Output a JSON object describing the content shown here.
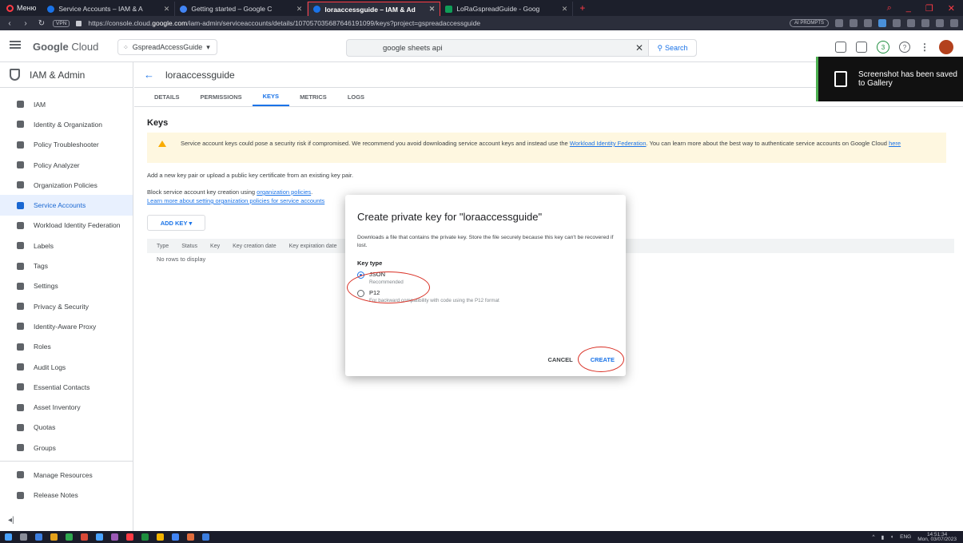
{
  "browser": {
    "menu_label": "Меню",
    "tabs": [
      {
        "label": "Service Accounts – IAM & A",
        "color": "#1a73e8",
        "active": false
      },
      {
        "label": "Getting started – Google C",
        "color": "#4285f4",
        "active": false
      },
      {
        "label": "loraaccessguide – IAM & Ad",
        "color": "#1a73e8",
        "active": true
      },
      {
        "label": "LoRaGspreadGuide - Goog",
        "color": "#0f9d58",
        "active": false
      }
    ],
    "url_prefix": "https://console.cloud.",
    "url_domain": "google.com",
    "url_suffix": "/iam-admin/serviceaccounts/details/107057035687646191099/keys?project=gspreadaccessguide",
    "vpn_label": "VPN",
    "ai_label": "AI PROMPTS"
  },
  "gcbar": {
    "logo_google": "Google",
    "logo_cloud": "Cloud",
    "project": "GspreadAccessGuide",
    "search_query": "google sheets api",
    "search_button": "Search",
    "notif_count": "3"
  },
  "toast": {
    "line1": "Screenshot has been saved",
    "line2": "to Gallery"
  },
  "sidebar": {
    "title": "IAM & Admin",
    "items": [
      {
        "label": "IAM"
      },
      {
        "label": "Identity & Organization"
      },
      {
        "label": "Policy Troubleshooter"
      },
      {
        "label": "Policy Analyzer"
      },
      {
        "label": "Organization Policies"
      },
      {
        "label": "Service Accounts"
      },
      {
        "label": "Workload Identity Federation"
      },
      {
        "label": "Labels"
      },
      {
        "label": "Tags"
      },
      {
        "label": "Settings"
      },
      {
        "label": "Privacy & Security"
      },
      {
        "label": "Identity-Aware Proxy"
      },
      {
        "label": "Roles"
      },
      {
        "label": "Audit Logs"
      },
      {
        "label": "Essential Contacts"
      },
      {
        "label": "Asset Inventory"
      },
      {
        "label": "Quotas"
      },
      {
        "label": "Groups"
      }
    ],
    "bottom_items": [
      {
        "label": "Manage Resources"
      },
      {
        "label": "Release Notes"
      }
    ],
    "collapse": "◂|"
  },
  "main": {
    "title": "loraaccessguide",
    "tabs": [
      "DETAILS",
      "PERMISSIONS",
      "KEYS",
      "METRICS",
      "LOGS"
    ],
    "keys_heading": "Keys",
    "warning_text": "Service account keys could pose a security risk if compromised. We recommend you avoid downloading service account keys and instead use the",
    "warning_link": "Workload Identity Federation",
    "warning_text2": ". You can learn more about the best way to authenticate service accounts on Google Cloud",
    "warning_here": "here",
    "add_text": "Add a new key pair or upload a public key certificate from an existing key pair.",
    "block_text": "Block service account key creation using",
    "block_link": "organization policies",
    "learn_link": "Learn more about setting organization policies for service accounts",
    "add_key": "ADD KEY",
    "columns": [
      "Type",
      "Status",
      "Key",
      "Key creation date",
      "Key expiration date"
    ],
    "no_rows": "No rows to display"
  },
  "modal": {
    "title": "Create private key for \"loraaccessguide\"",
    "description": "Downloads a file that contains the private key. Store the file securely because this key can't be recovered if lost.",
    "key_type_label": "Key type",
    "options": [
      {
        "label": "JSON",
        "sub": "Recommended",
        "selected": true
      },
      {
        "label": "P12",
        "sub": "For backward compatibility with code using the P12 format",
        "selected": false
      }
    ],
    "cancel": "CANCEL",
    "create": "CREATE"
  },
  "taskbar": {
    "lang": "ENG",
    "time": "14:51:34",
    "date": "Mon, 03/07/2023"
  }
}
